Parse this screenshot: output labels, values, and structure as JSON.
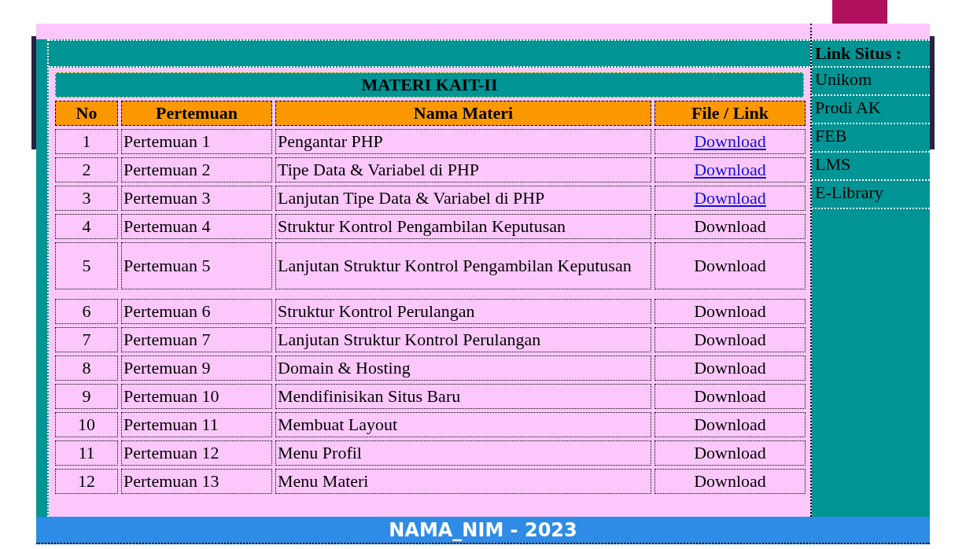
{
  "table": {
    "title": "MATERI KAIT-II",
    "columns": [
      "No",
      "Pertemuan",
      "Nama Materi",
      "File / Link"
    ],
    "rows": [
      {
        "no": "1",
        "meeting": "Pertemuan 1",
        "material": "Pengantar PHP",
        "file": "Download",
        "linked": true
      },
      {
        "no": "2",
        "meeting": "Pertemuan 2",
        "material": "Tipe Data & Variabel di PHP",
        "file": "Download",
        "linked": true
      },
      {
        "no": "3",
        "meeting": "Pertemuan 3",
        "material": "Lanjutan Tipe Data & Variabel di PHP",
        "file": "Download",
        "linked": true
      },
      {
        "no": "4",
        "meeting": "Pertemuan 4",
        "material": "Struktur Kontrol Pengambilan Keputusan",
        "file": "Download",
        "linked": false
      },
      {
        "no": "5",
        "meeting": "Pertemuan 5",
        "material": "Lanjutan Struktur Kontrol Pengambilan Keputusan",
        "file": "Download",
        "linked": false
      },
      {
        "no": "6",
        "meeting": "Pertemuan 6",
        "material": "Struktur Kontrol Perulangan",
        "file": "Download",
        "linked": false
      },
      {
        "no": "7",
        "meeting": "Pertemuan 7",
        "material": "Lanjutan Struktur Kontrol Perulangan",
        "file": "Download",
        "linked": false
      },
      {
        "no": "8",
        "meeting": "Pertemuan 9",
        "material": "Domain & Hosting",
        "file": "Download",
        "linked": false
      },
      {
        "no": "9",
        "meeting": "Pertemuan 10",
        "material": "Mendifinisikan Situs Baru",
        "file": "Download",
        "linked": false
      },
      {
        "no": "10",
        "meeting": "Pertemuan 11",
        "material": "Membuat Layout",
        "file": "Download",
        "linked": false
      },
      {
        "no": "11",
        "meeting": "Pertemuan 12",
        "material": "Menu Profil",
        "file": "Download",
        "linked": false
      },
      {
        "no": "12",
        "meeting": "Pertemuan 13",
        "material": "Menu Materi",
        "file": "Download",
        "linked": false
      }
    ]
  },
  "sidebar": {
    "heading": "Link Situs :",
    "items": [
      "Unikom",
      "Prodi AK",
      "FEB",
      "LMS",
      "E-Library"
    ]
  },
  "footer": "NAMA_NIM - 2023"
}
